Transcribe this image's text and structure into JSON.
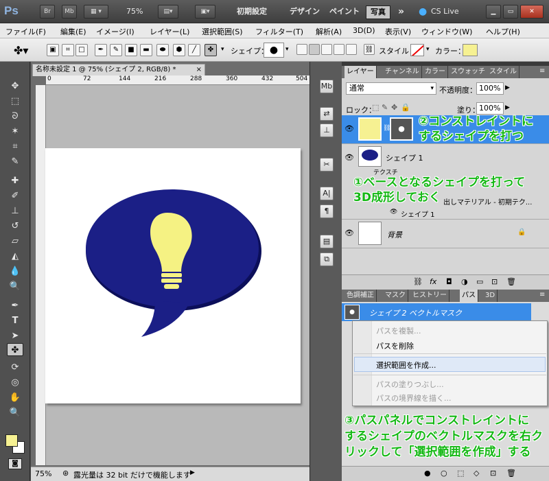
{
  "app": {
    "logo": "Ps",
    "bridge": "Br",
    "minibridge": "Mb",
    "zoom": "75%",
    "workspaces": [
      "初期設定",
      "デザイン",
      "ペイント",
      "写真"
    ],
    "more": "»",
    "cslive": "CS Live"
  },
  "menu": [
    "ファイル(F)",
    "編集(E)",
    "イメージ(I)",
    "レイヤー(L)",
    "選択範囲(S)",
    "フィルター(T)",
    "解析(A)",
    "3D(D)",
    "表示(V)",
    "ウィンドウ(W)",
    "ヘルプ(H)"
  ],
  "options": {
    "shape_label": "シェイプ：",
    "style_label": "スタイル：",
    "color_label": "カラー：",
    "color": "#f6f192"
  },
  "document": {
    "tab": "名称未設定 1 @ 75% (シェイプ 2, RGB/8) *",
    "close": "×",
    "ruler_ticks": [
      "0",
      "72",
      "144",
      "216",
      "288",
      "360",
      "432",
      "504"
    ],
    "zoom": "75%",
    "status": "露光量は 32 bit だけで機能します"
  },
  "bubble": {
    "color": "#1b1f86",
    "bulb_color": "#f5f283"
  },
  "layers_panel": {
    "tabs": [
      "レイヤー",
      "チャンネル",
      "カラー",
      "スウォッチ",
      "スタイル"
    ],
    "blend_mode": "通常",
    "opacity_label": "不透明度：",
    "opacity": "100%",
    "lock_label": "ロック：",
    "fill_label": "塗り：",
    "fill": "100%",
    "layers": [
      {
        "name": ""
      },
      {
        "name": "シェイプ 1",
        "sub_effect": "テクスチ",
        "sub_material": "出しマテリアル - 初期テク...",
        "sub_shape": "シェイプ 1"
      },
      {
        "name": "背景"
      }
    ]
  },
  "paths_panel": {
    "tabs": [
      "色調補正",
      "マスク",
      "ヒストリー",
      "パス",
      "3D"
    ],
    "path_name": "シェイプ 2 ベクトルマスク"
  },
  "context_menu": [
    {
      "label": "パスを複製...",
      "enabled": false
    },
    {
      "label": "パスを削除",
      "enabled": true
    },
    {
      "label": "選択範囲を作成...",
      "enabled": true,
      "highlighted": true
    },
    {
      "label": "パスの塗りつぶし...",
      "enabled": false
    },
    {
      "label": "パスの境界線を描く...",
      "enabled": false
    }
  ],
  "annotations": {
    "a2_l1": "②コンストレイントに",
    "a2_l2": "するシェイプを打つ",
    "a1_l1": "①ベースとなるシェイプを打って",
    "a1_l2": "3D成形しておく",
    "a3_l1": "③パスパネルでコンストレイントに",
    "a3_l2": "するシェイプのベクトルマスクを右ク",
    "a3_l3": "リックして「選択範囲を作成」する"
  }
}
